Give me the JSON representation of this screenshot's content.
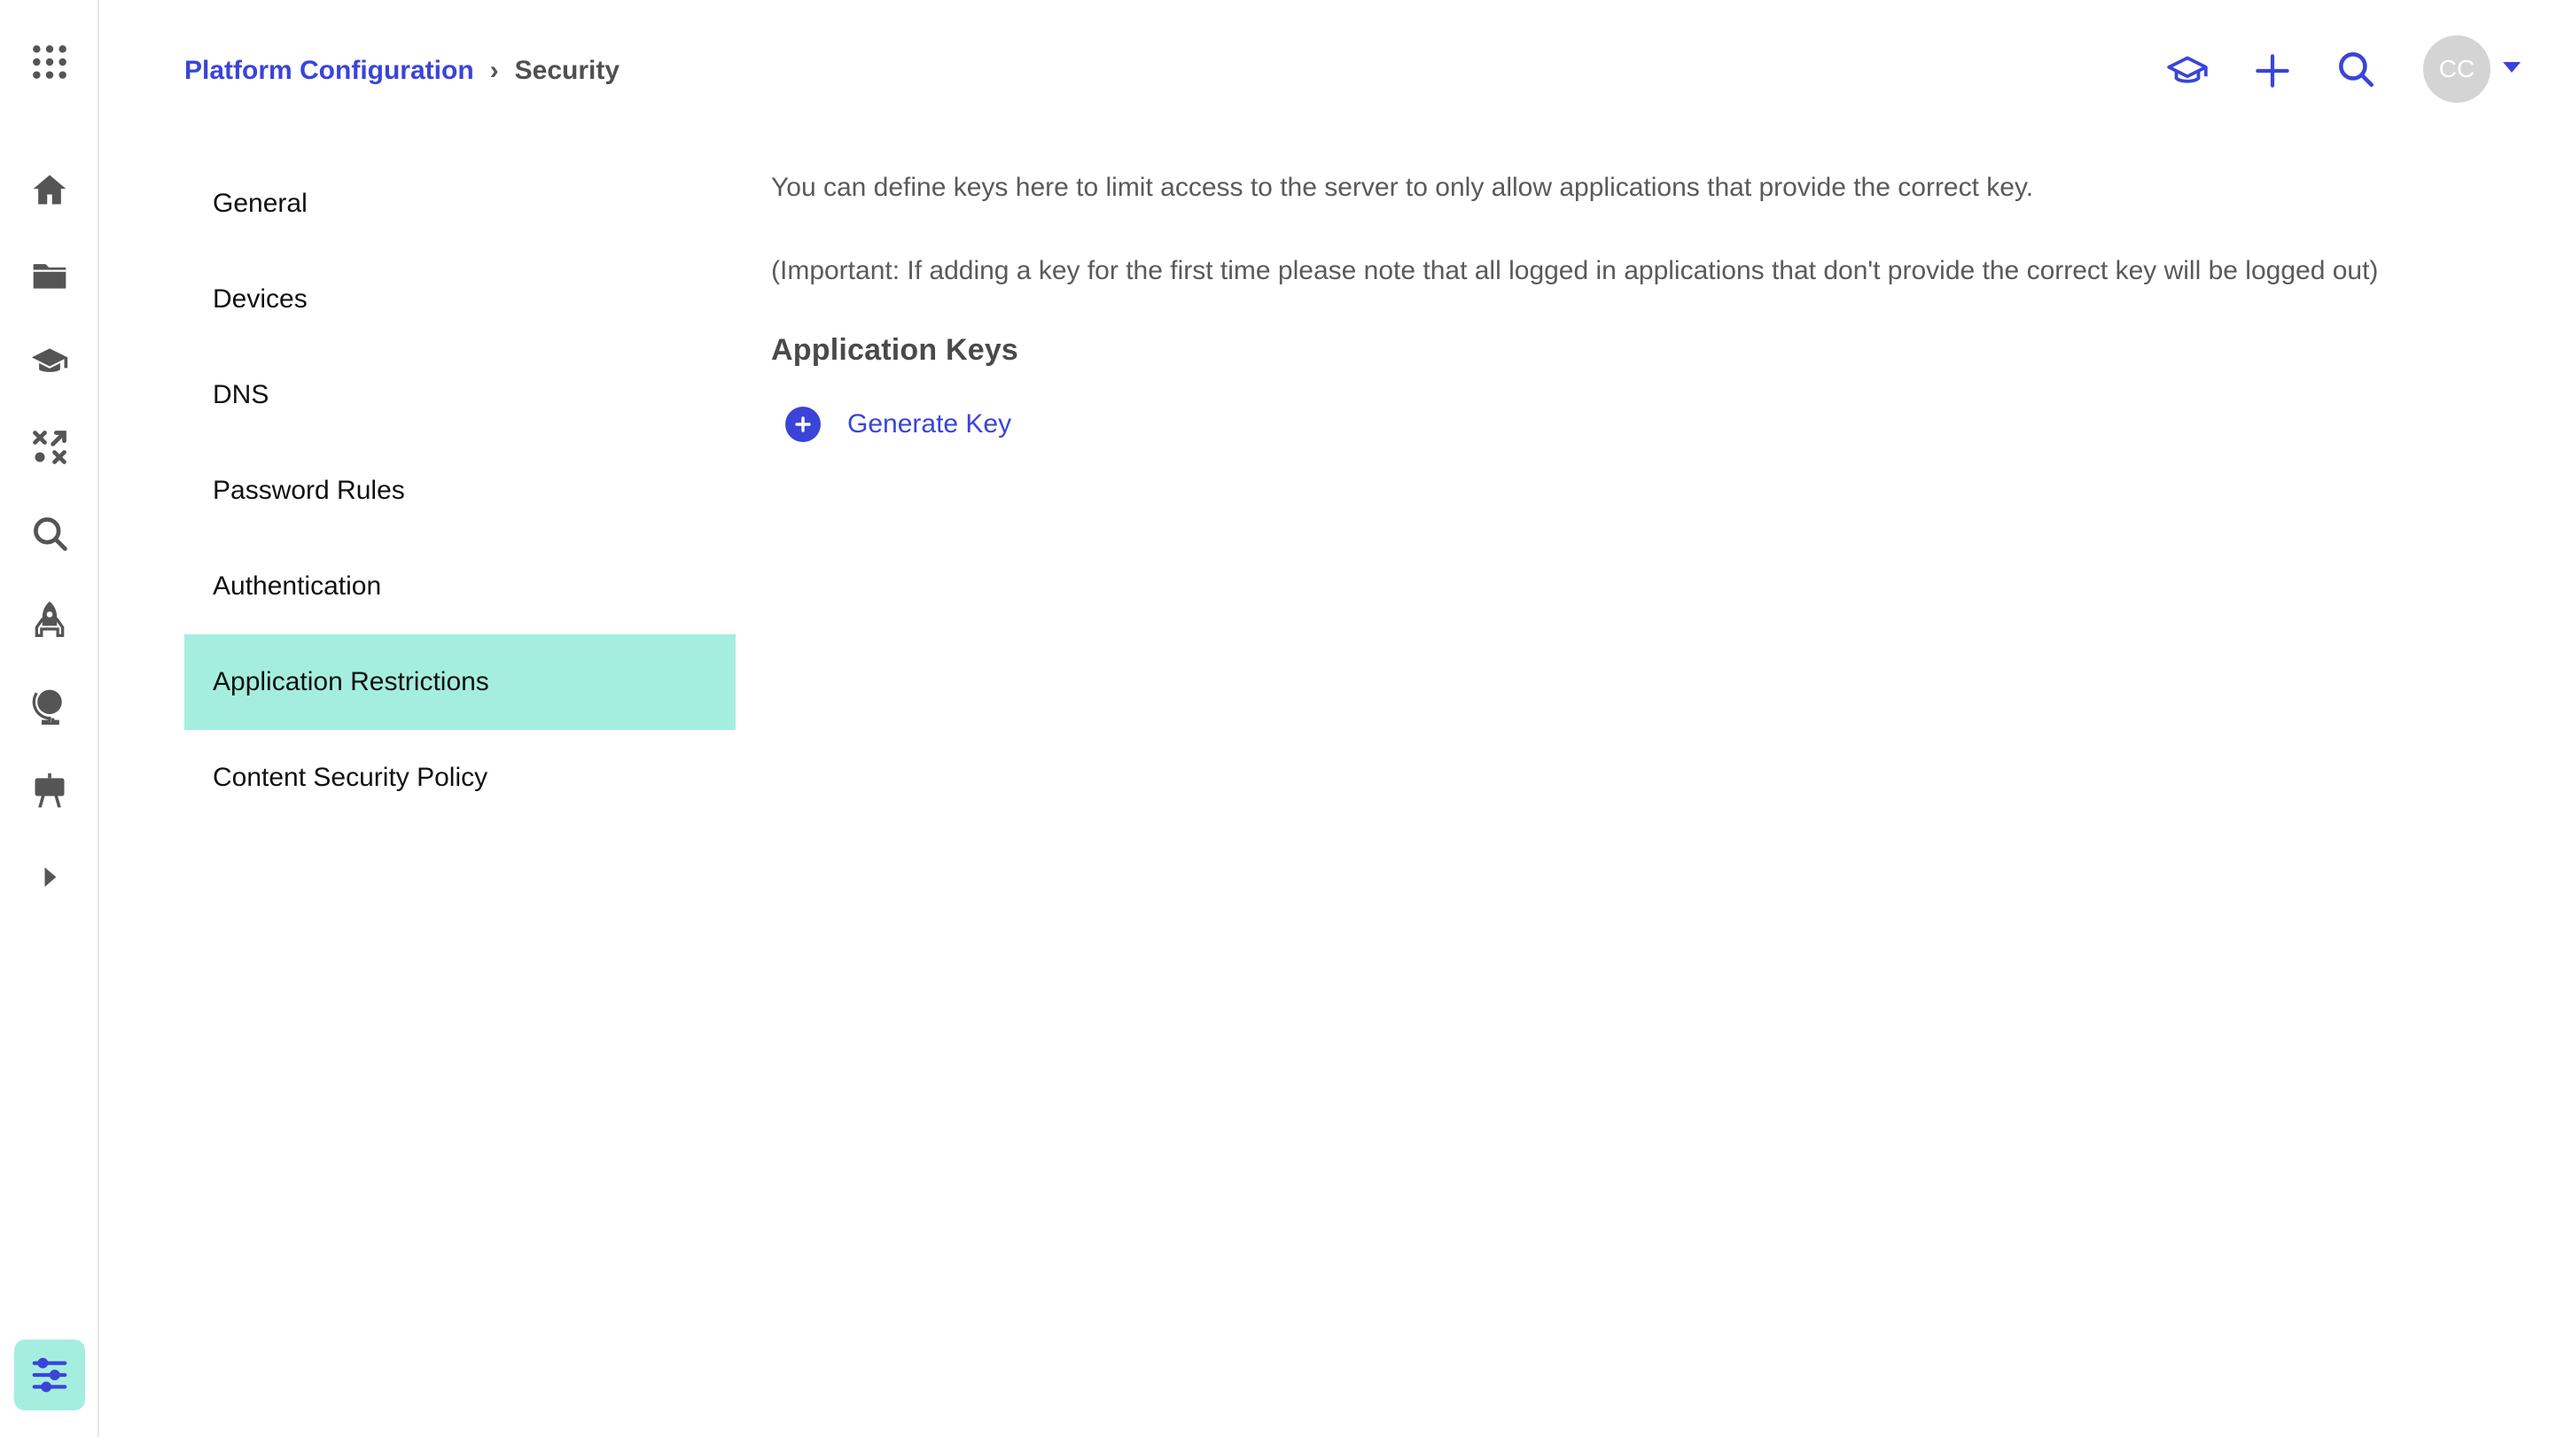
{
  "breadcrumb": {
    "parent": "Platform Configuration",
    "separator": "›",
    "current": "Security"
  },
  "header": {
    "avatar_initials": "CC",
    "icons": [
      "graduation-cap-icon",
      "plus-icon",
      "search-icon",
      "chevron-down-icon"
    ]
  },
  "rail": {
    "items": [
      "apps-grid-icon",
      "home-icon",
      "folder-icon",
      "graduation-cap-icon",
      "tools-icon",
      "search-icon",
      "rocket-icon",
      "globe-icon",
      "presentation-icon",
      "expand-icon"
    ],
    "bottom": "settings-sliders-icon"
  },
  "settings_nav": {
    "items": [
      {
        "label": "General",
        "active": false
      },
      {
        "label": "Devices",
        "active": false
      },
      {
        "label": "DNS",
        "active": false
      },
      {
        "label": "Password Rules",
        "active": false
      },
      {
        "label": "Authentication",
        "active": false
      },
      {
        "label": "Application Restrictions",
        "active": true
      },
      {
        "label": "Content Security Policy",
        "active": false
      }
    ]
  },
  "main": {
    "description": "You can define keys here to limit access to the server to only allow applications that provide the correct key.",
    "note": "(Important: If adding a key for the first time please note that all logged in applications that don't provide the correct key will be logged out)",
    "section_title": "Application Keys",
    "generate_key_label": "Generate Key"
  },
  "colors": {
    "accent": "#3a44d8",
    "active_bg": "#a5eedf",
    "icon_gray": "#666666",
    "avatar_bg": "#d4d4d4"
  }
}
